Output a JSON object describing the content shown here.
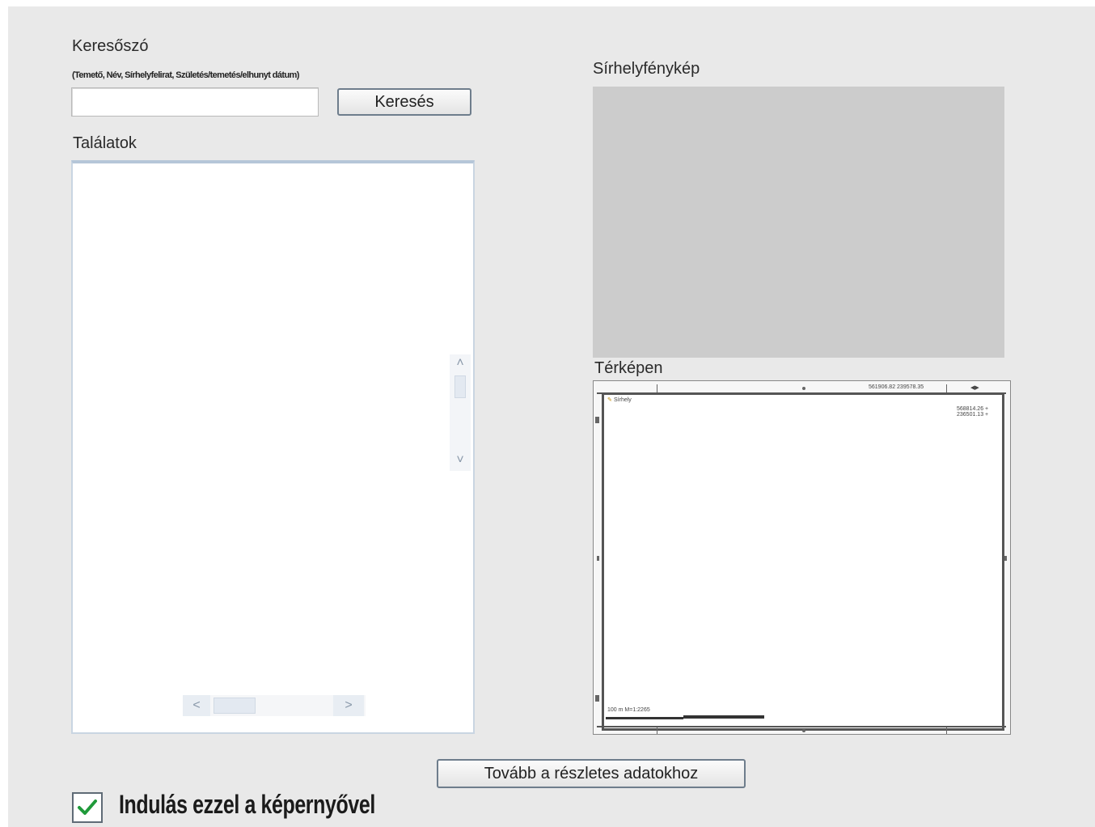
{
  "search": {
    "label": "Keresőszó",
    "hint": "(Temető, Név, Sírhelyfelirat, Születés/temetés/elhunyt dátum)",
    "input_value": "",
    "button_label": "Keresés"
  },
  "results": {
    "label": "Találatok"
  },
  "photo": {
    "label": "Sírhelyfénykép"
  },
  "map": {
    "label": "Térképen",
    "coord_top": "561906.82 239578.35",
    "coord_right": "568814.26 +\n236501.13 +",
    "legend": "Sírhely",
    "scale_text": "100 m  M=1:2265"
  },
  "next_button": {
    "label": "Tovább a részletes adatokhoz"
  },
  "startup": {
    "checked": true,
    "label": "Indulás ezzel a képernyővel"
  }
}
